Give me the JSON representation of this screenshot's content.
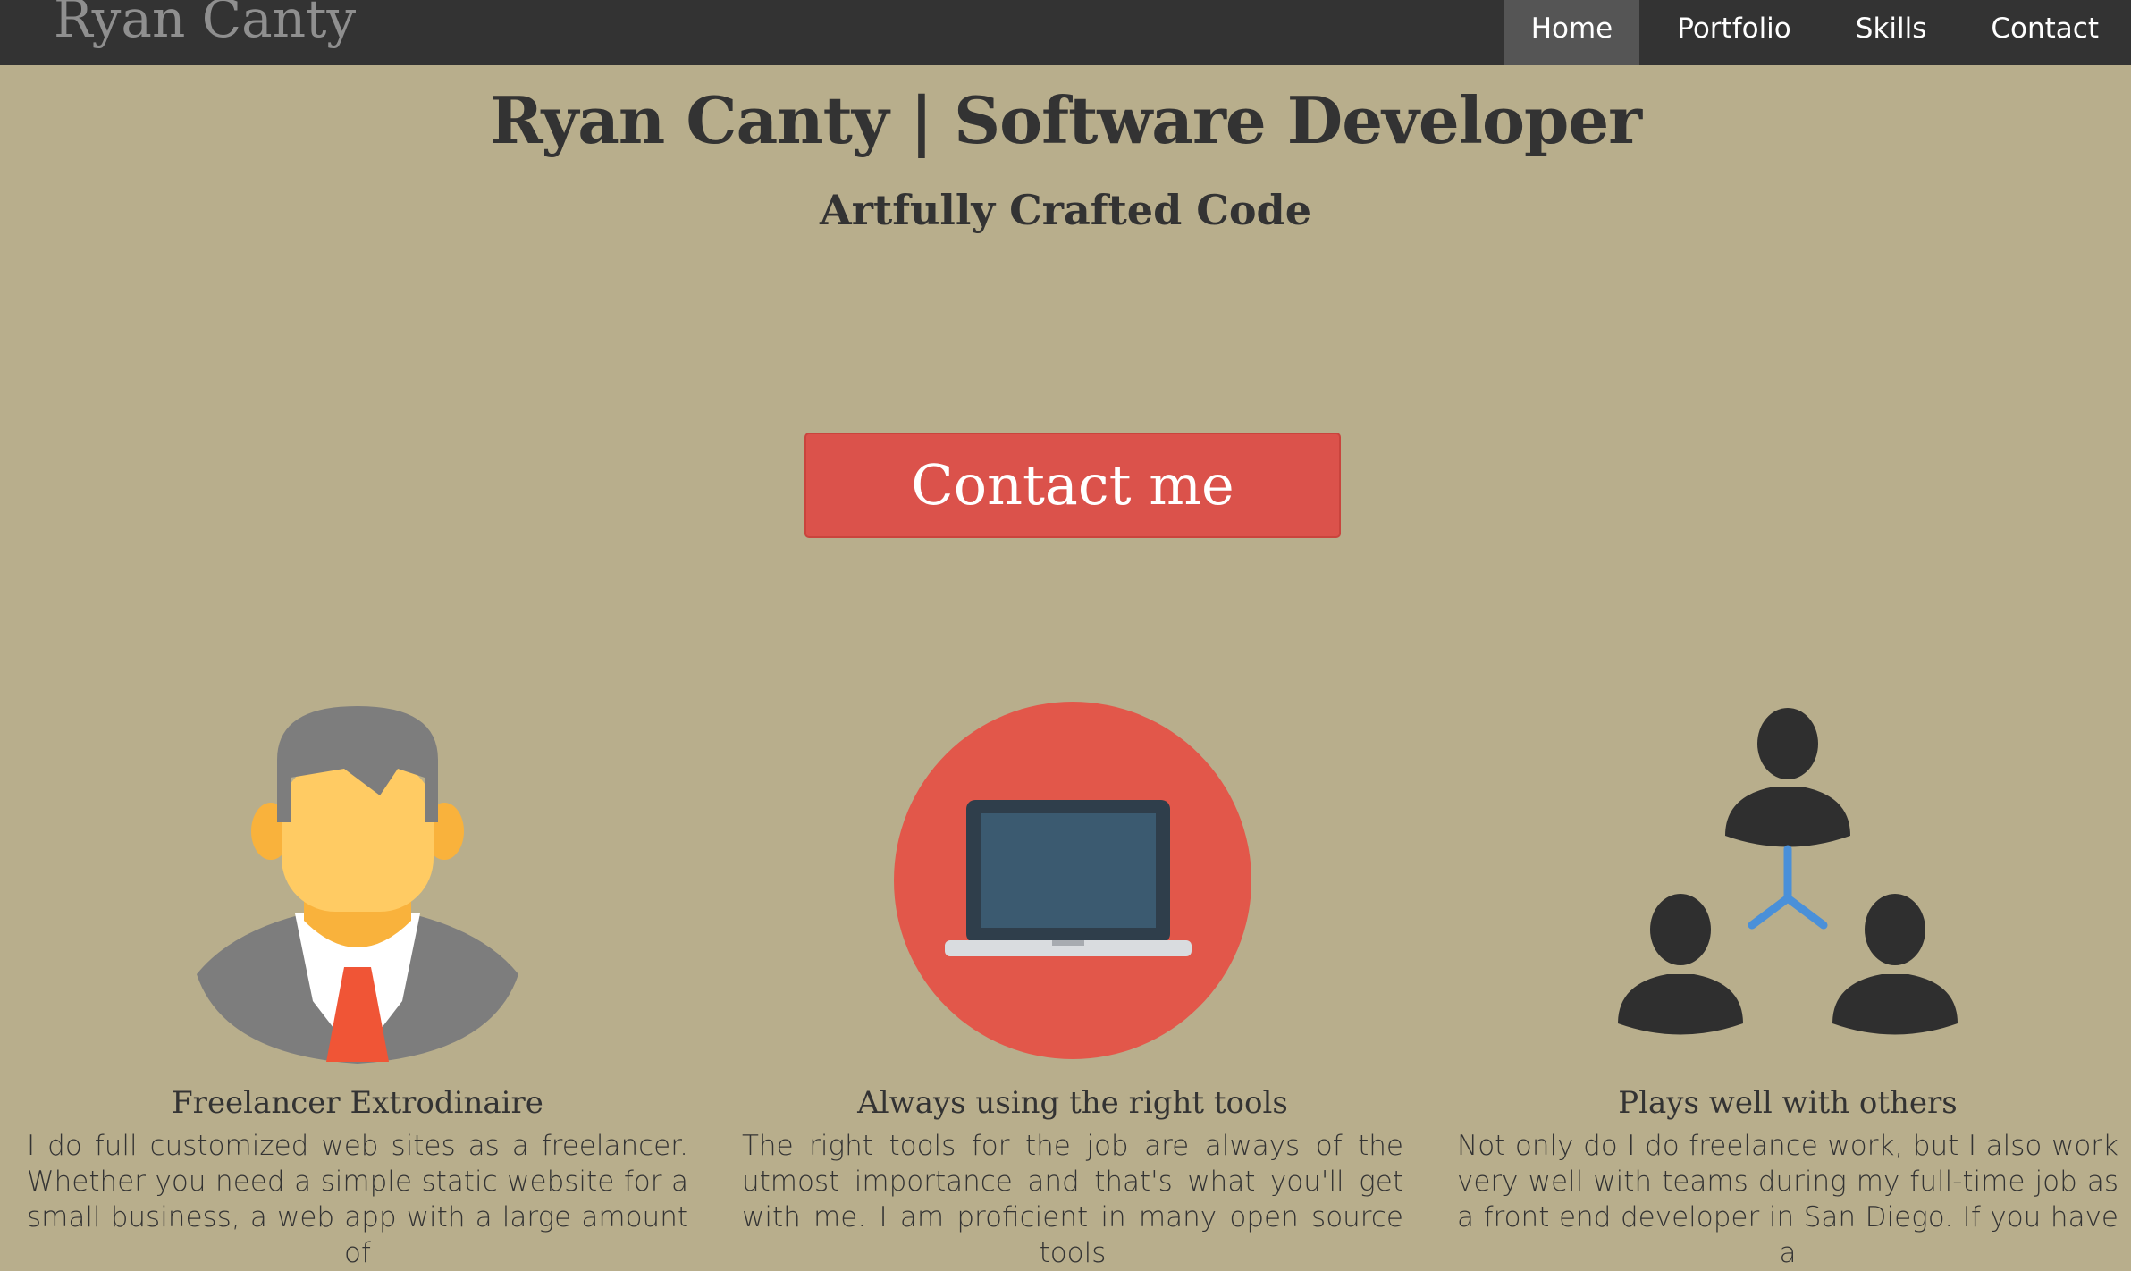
{
  "nav": {
    "brand": "Ryan Canty",
    "items": [
      {
        "label": "Home",
        "active": true
      },
      {
        "label": "Portfolio",
        "active": false
      },
      {
        "label": "Skills",
        "active": false
      },
      {
        "label": "Contact",
        "active": false
      }
    ]
  },
  "hero": {
    "title": "Ryan Canty | Software Developer",
    "subtitle": "Artfully Crafted Code",
    "cta_label": "Contact me"
  },
  "features": [
    {
      "icon": "businessman-icon",
      "heading": "Freelancer Extrodinaire",
      "text": "I do full customized web sites as a freelancer. Whether you need a simple static website for a small business, a web app with a large amount of"
    },
    {
      "icon": "laptop-icon",
      "heading": "Always using the right tools",
      "text": "The right tools for the job are always of the utmost importance and that's what you'll get with me. I am proficient in many open source tools"
    },
    {
      "icon": "team-icon",
      "heading": "Plays well with others",
      "text": "Not only do I do freelance work, but I also work very well with teams during my full-time job as a front end developer in San Diego. If you have a"
    }
  ],
  "colors": {
    "background": "#b8ae8c",
    "navbar": "#333333",
    "nav_active": "#555555",
    "cta": "#db524b",
    "text": "#333333"
  }
}
